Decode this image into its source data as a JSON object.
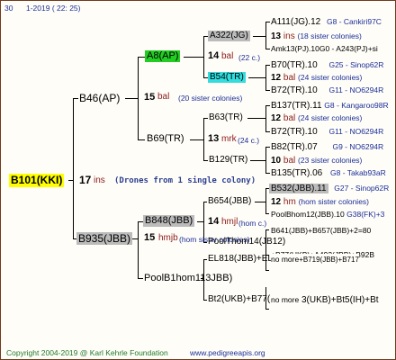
{
  "header": {
    "num": "30",
    "date": "1-2019 ( 22: 25)"
  },
  "footer": {
    "copyright": "Copyright 2004-2019 @ Karl Kehrle Foundation",
    "site": "www.pedigreeapis.org"
  },
  "root": {
    "label": "B101(KKI)",
    "num": "17",
    "mark": "ins",
    "note": "(Drones from 1 single colony)"
  },
  "colors": {
    "root_bg": "#ffff00",
    "a8_bg": "#22cc22",
    "b54_bg": "#33dddd",
    "grey_bg": "#bbbbbb",
    "line": "#000000"
  },
  "nodes": {
    "b46": "B46(AP)",
    "b46_info": {
      "num": "15",
      "mark": "bal",
      "note": "(20 sister colonies)"
    },
    "a8": "A8(AP)",
    "a8_info": {
      "num": "14",
      "mark": "bal",
      "note": "(22 c.)"
    },
    "a322": "A322(JG)",
    "b54": "B54(TR)",
    "b69": "B69(TR)",
    "b69_info": {
      "num": "13",
      "mark": "mrk",
      "note": "(24 c.)"
    },
    "b63": "B63(TR)",
    "b129": "B129(TR)",
    "b935": "B935(JBB)",
    "b935_info": {
      "num": "15",
      "mark": "hmjb",
      "note": "(hom sister colonies)"
    },
    "b848": "B848(JBB)",
    "b848_info": {
      "num": "14",
      "mark": "hmjl",
      "note": "(hom c.)"
    },
    "b654": "B654(JBB)",
    "poolthom": "PoolThom14(JB",
    "poolthom_num": "12)",
    "poolb1": "PoolB1hom113",
    "poolb1_suffix": "JBB)",
    "el818": "EL818(JBB)+EL79",
    "bt2": "Bt2(UKB)+B77(Ul"
  },
  "right": [
    {
      "a": "A111(JG).12",
      "b": "G8 - Cankiri97C"
    },
    {
      "num": "13",
      "mark": "ins",
      "note": "(18 sister colonies)"
    },
    {
      "a": "Amk13(PJ).10G0 - A243(PJ)+si"
    },
    {
      "a": "B70(TR).10",
      "b": "G25 - Sinop62R"
    },
    {
      "num": "12",
      "mark": "bal",
      "note": "(24 sister colonies)"
    },
    {
      "a": "B72(TR).10",
      "b": "G11 - NO6294R"
    },
    {
      "a": "B137(TR).11",
      "b": "G8 - Kangaroo98R"
    },
    {
      "num": "12",
      "mark": "bal",
      "note": "(24 sister colonies)"
    },
    {
      "a": "B72(TR).10",
      "b": "G11 - NO6294R"
    },
    {
      "a": "B82(TR).07",
      "b": "G9 - NO6294R"
    },
    {
      "num": "10",
      "mark": "bal",
      "note": "(23 sister colonies)"
    },
    {
      "a": "B135(TR).06",
      "b": "G8 - Takab93aR"
    },
    {
      "a": "B532(JBB).11",
      "b": "G27 - Sinop62R"
    },
    {
      "num": "12",
      "mark": "hm",
      "note": "(hom sister colonies)"
    },
    {
      "a": "PoolBhom12(JBB).10",
      "b": "G38(FK)+3"
    },
    {
      "a": "B641(JBB)+B657(JBB)+2=80"
    },
    {
      "a": "+B77(UKB)+A493(JBB)+B92B"
    },
    {
      "a": "no more",
      "b": "+B719(JBB)+B717"
    },
    {
      "a": "no more",
      "b": "3(UKB)+Bt5(IH)+Bt"
    }
  ]
}
